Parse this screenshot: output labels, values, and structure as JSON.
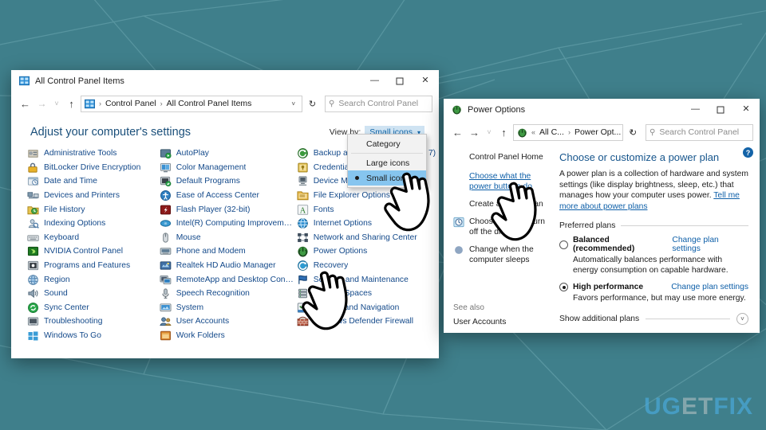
{
  "background": {
    "color": "#3f7f8b",
    "line_color": "#5a98a2"
  },
  "watermark": {
    "part1": "UG",
    "part2": "ET",
    "part3": "FIX"
  },
  "control_panel_window": {
    "title": "All Control Panel Items",
    "title_icon": "control-panel-icon",
    "window_buttons": {
      "minimize": "—",
      "maximize": "☐",
      "close": "✕"
    },
    "nav": {
      "back": "←",
      "forward": "→",
      "recent": "˅",
      "up": "↑",
      "refresh": "↻",
      "caret": "˅"
    },
    "breadcrumb": {
      "root": "Control Panel",
      "current": "All Control Panel Items",
      "separator": "›"
    },
    "search": {
      "placeholder": "Search Control Panel",
      "icon": "search-icon"
    },
    "heading": "Adjust your computer's settings",
    "view_by": {
      "label": "View by:",
      "value": "Small icons",
      "caret": "▾",
      "options": [
        "Category",
        "Large icons",
        "Small icons"
      ],
      "selected": "Small icons"
    },
    "columns": [
      [
        {
          "label": "Administrative Tools",
          "icon": "admin-tools-icon"
        },
        {
          "label": "BitLocker Drive Encryption",
          "icon": "bitlocker-icon"
        },
        {
          "label": "Date and Time",
          "icon": "date-time-icon"
        },
        {
          "label": "Devices and Printers",
          "icon": "devices-printers-icon"
        },
        {
          "label": "File History",
          "icon": "file-history-icon"
        },
        {
          "label": "Indexing Options",
          "icon": "indexing-options-icon"
        },
        {
          "label": "Keyboard",
          "icon": "keyboard-icon"
        },
        {
          "label": "NVIDIA Control Panel",
          "icon": "nvidia-icon"
        },
        {
          "label": "Programs and Features",
          "icon": "programs-features-icon"
        },
        {
          "label": "Region",
          "icon": "region-icon"
        },
        {
          "label": "Sound",
          "icon": "sound-icon"
        },
        {
          "label": "Sync Center",
          "icon": "sync-center-icon"
        },
        {
          "label": "Troubleshooting",
          "icon": "troubleshooting-icon"
        },
        {
          "label": "Windows To Go",
          "icon": "windows-to-go-icon"
        }
      ],
      [
        {
          "label": "AutoPlay",
          "icon": "autoplay-icon"
        },
        {
          "label": "Color Management",
          "icon": "color-management-icon"
        },
        {
          "label": "Default Programs",
          "icon": "default-programs-icon"
        },
        {
          "label": "Ease of Access Center",
          "icon": "ease-of-access-icon"
        },
        {
          "label": "Flash Player (32-bit)",
          "icon": "flash-player-icon"
        },
        {
          "label": "Intel(R) Computing Improvement Pr...",
          "icon": "intel-icon"
        },
        {
          "label": "Mouse",
          "icon": "mouse-icon"
        },
        {
          "label": "Phone and Modem",
          "icon": "phone-modem-icon"
        },
        {
          "label": "Realtek HD Audio Manager",
          "icon": "realtek-icon"
        },
        {
          "label": "RemoteApp and Desktop Connections",
          "icon": "remoteapp-icon"
        },
        {
          "label": "Speech Recognition",
          "icon": "speech-recognition-icon"
        },
        {
          "label": "System",
          "icon": "system-icon"
        },
        {
          "label": "User Accounts",
          "icon": "user-accounts-icon"
        },
        {
          "label": "Work Folders",
          "icon": "work-folders-icon"
        }
      ],
      [
        {
          "label": "Backup and Restore (Windows 7)",
          "icon": "backup-restore-icon"
        },
        {
          "label": "Credential Manager",
          "icon": "credential-manager-icon"
        },
        {
          "label": "Device Manager",
          "icon": "device-manager-icon"
        },
        {
          "label": "File Explorer Options",
          "icon": "file-explorer-options-icon"
        },
        {
          "label": "Fonts",
          "icon": "fonts-icon"
        },
        {
          "label": "Internet Options",
          "icon": "internet-options-icon"
        },
        {
          "label": "Network and Sharing Center",
          "icon": "network-sharing-icon"
        },
        {
          "label": "Power Options",
          "icon": "power-options-icon"
        },
        {
          "label": "Recovery",
          "icon": "recovery-icon"
        },
        {
          "label": "Security and Maintenance",
          "icon": "security-maintenance-icon"
        },
        {
          "label": "Storage Spaces",
          "icon": "storage-spaces-icon"
        },
        {
          "label": "Taskbar and Navigation",
          "icon": "taskbar-navigation-icon"
        },
        {
          "label": "Windows Defender Firewall",
          "icon": "windows-firewall-icon"
        }
      ]
    ]
  },
  "power_options_window": {
    "title": "Power Options",
    "title_icon": "power-options-icon",
    "window_buttons": {
      "minimize": "—",
      "maximize": "☐",
      "close": "✕"
    },
    "nav": {
      "back": "←",
      "forward": "→",
      "recent": "˅",
      "up": "↑",
      "refresh": "↻",
      "caret": "˅"
    },
    "breadcrumb": {
      "chevrons": "«",
      "root": "All C...",
      "current": "Power Opt...",
      "separator": "›"
    },
    "search": {
      "placeholder": "Search Control Panel",
      "icon": "search-icon"
    },
    "help_icon": "?",
    "sidebar": {
      "home": "Control Panel Home",
      "links": [
        {
          "label": "Choose what the power buttons do",
          "icon": null,
          "link": true
        },
        {
          "label": "Create a power plan",
          "icon": null,
          "link": false
        },
        {
          "label": "Choose when to turn off the display",
          "icon": "clock-icon",
          "link": false
        },
        {
          "label": "Change when the computer sleeps",
          "icon": "moon-icon",
          "link": false
        }
      ],
      "see_also_title": "See also",
      "see_also_link": "User Accounts"
    },
    "main": {
      "title": "Choose or customize a power plan",
      "description": "A power plan is a collection of hardware and system settings (like display brightness, sleep, etc.) that manages how your computer uses power.",
      "description_link": "Tell me more about power plans",
      "group_label": "Preferred plans",
      "plans": [
        {
          "name": "Balanced (recommended)",
          "selected": false,
          "description": "Automatically balances performance with energy consumption on capable hardware.",
          "link": "Change plan settings"
        },
        {
          "name": "High performance",
          "selected": true,
          "description": "Favors performance, but may use more energy.",
          "link": "Change plan settings"
        }
      ],
      "show_more_label": "Show additional plans",
      "show_more_caret": "˅"
    }
  }
}
